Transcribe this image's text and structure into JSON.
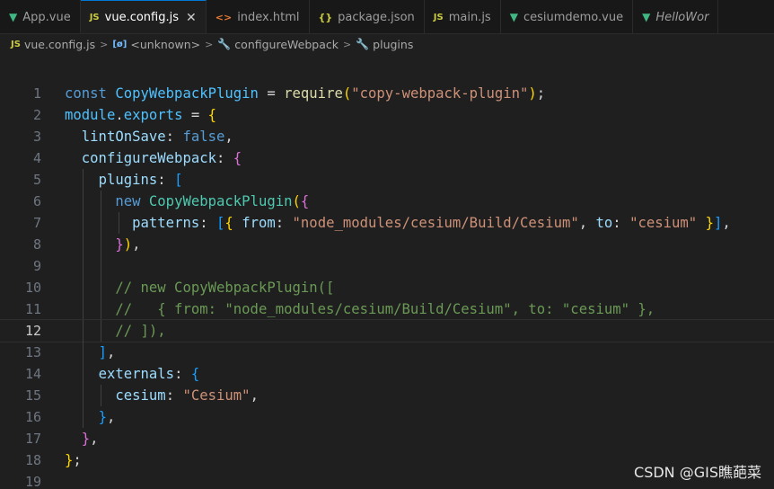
{
  "tabs": [
    {
      "label": "App.vue",
      "icon": "vue-icon",
      "active": false
    },
    {
      "label": "vue.config.js",
      "icon": "js-icon",
      "active": true
    },
    {
      "label": "index.html",
      "icon": "html-icon",
      "active": false
    },
    {
      "label": "package.json",
      "icon": "json-icon",
      "active": false
    },
    {
      "label": "main.js",
      "icon": "js-icon",
      "active": false
    },
    {
      "label": "cesiumdemo.vue",
      "icon": "vue-icon",
      "active": false
    },
    {
      "label": "HelloWor",
      "icon": "vue-icon",
      "active": false
    }
  ],
  "glyphs": {
    "js": "JS",
    "vue": "▼",
    "html": "<>",
    "json": "{}",
    "close": "✕",
    "module": "[ø]",
    "wrench": "🔧",
    "chevron": ">"
  },
  "breadcrumb": [
    "vue.config.js",
    "<unknown>",
    "configureWebpack",
    "plugins"
  ],
  "editor": {
    "current_line": 12,
    "line_numbers": [
      "1",
      "2",
      "3",
      "4",
      "5",
      "6",
      "7",
      "8",
      "9",
      "10",
      "11",
      "12",
      "13",
      "14",
      "15",
      "16",
      "17",
      "18",
      "19"
    ],
    "lines": [
      "const CopyWebpackPlugin = require(\"copy-webpack-plugin\");",
      "module.exports = {",
      "  lintOnSave: false,",
      "  configureWebpack: {",
      "    plugins: [",
      "      new CopyWebpackPlugin({",
      "        patterns: [{ from: \"node_modules/cesium/Build/Cesium\", to: \"cesium\" }],",
      "      }),",
      "",
      "      // new CopyWebpackPlugin([",
      "      //   { from: \"node_modules/cesium/Build/Cesium\", to: \"cesium\" },",
      "      // ]),",
      "    ],",
      "    externals: {",
      "      cesium: \"Cesium\",",
      "    },",
      "  },",
      "};",
      ""
    ]
  },
  "watermark": "CSDN @GIS瞧葩菜",
  "colors": {
    "accent": "#0078d4",
    "background": "#1f1f1f",
    "tabbar": "#181818"
  }
}
